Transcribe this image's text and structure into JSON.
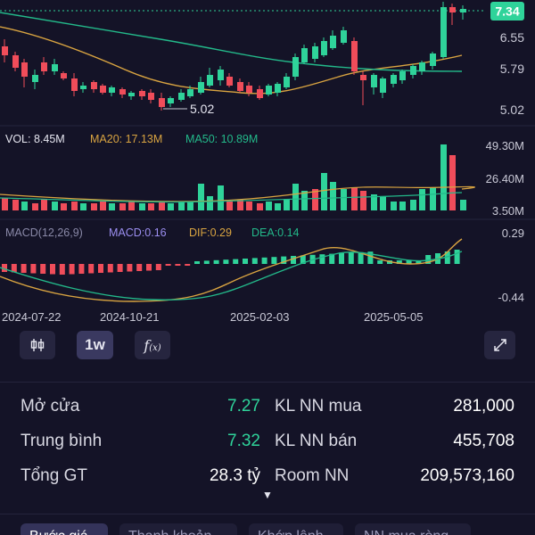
{
  "price_axis": {
    "current": "7.34",
    "t1": "6.55",
    "t2": "5.79",
    "t3": "5.02"
  },
  "price_annotation": "5.02",
  "volume": {
    "vol_label": "VOL: 8.45M",
    "ma20_label": "MA20: 17.13M",
    "ma50_label": "MA50: 10.89M",
    "axis": {
      "top": "49.30M",
      "mid": "26.40M",
      "bottom": "3.50M"
    }
  },
  "macd": {
    "name_label": "MACD(12,26,9)",
    "macd_label": "MACD:0.16",
    "dif_label": "DIF:0.29",
    "dea_label": "DEA:0.14",
    "axis": {
      "top": "0.29",
      "bottom": "-0.44"
    }
  },
  "dates": [
    "2024-07-22",
    "2024-10-21",
    "2025-02-03",
    "2025-05-05"
  ],
  "toolbar": {
    "chart_type_icon": "candlestick-icon",
    "interval_label": "1w",
    "indicator_icon": "function-icon",
    "expand_icon": "expand-icon"
  },
  "stats": {
    "open_label": "Mở cửa",
    "open_value": "7.27",
    "avg_label": "Trung bình",
    "avg_value": "7.32",
    "total_label": "Tổng GT",
    "total_value": "28.3 tỷ",
    "fb_label": "KL NN mua",
    "fb_value": "281,000",
    "fs_label": "KL NN bán",
    "fs_value": "455,708",
    "room_label": "Room NN",
    "room_value": "209,573,160",
    "more_icon": "caret-down-icon"
  },
  "tabs": [
    "Bước giá",
    "Thanh khoản",
    "Khớp lệnh",
    "NN mua ròng"
  ],
  "colors": {
    "up": "#2fd39a",
    "down": "#f04d5a",
    "ma_yellow": "#d9a441",
    "ma_green": "#23b98a",
    "background": "#141327"
  }
}
